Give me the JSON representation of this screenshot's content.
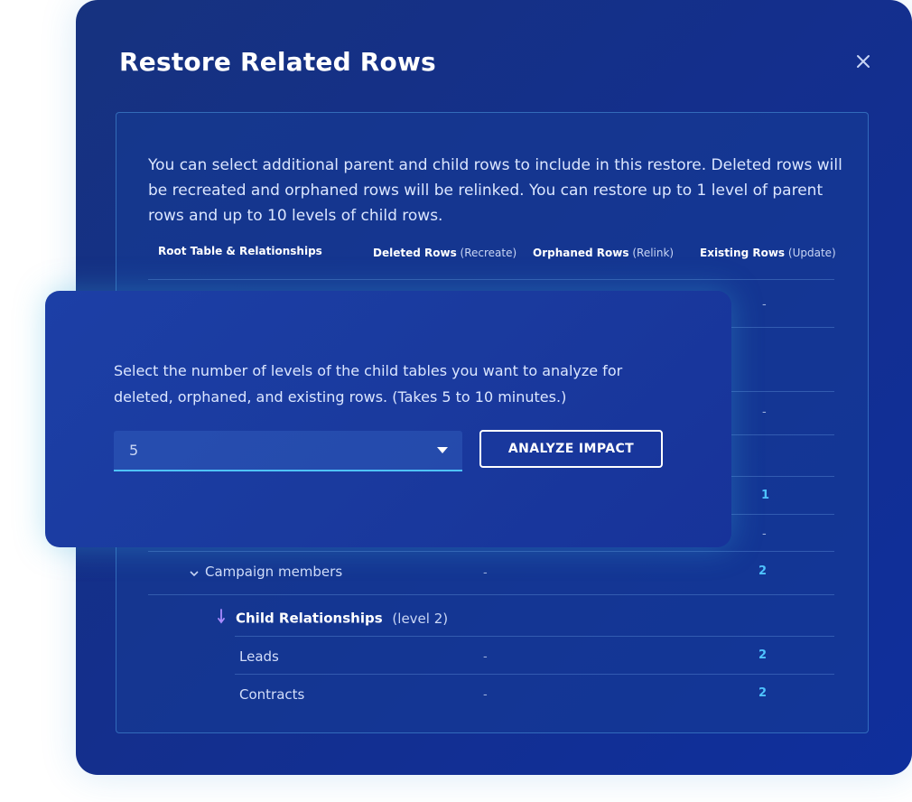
{
  "dialog": {
    "title": "Restore Related Rows",
    "intro": "You can select additional parent and child rows to include in this restore. Deleted rows will be recreated and orphaned rows will be relinked. You can restore up to 1 level of parent rows and up to 10 levels of child rows."
  },
  "table": {
    "headers": {
      "root": "Root Table & Relationships",
      "deleted": "Deleted Rows",
      "deleted_note": "(Recreate)",
      "orphaned": "Orphaned Rows",
      "orphaned_note": "(Relink)",
      "existing": "Existing Rows",
      "existing_note": "(Update)"
    },
    "partial_values": [
      "-",
      "-",
      "1",
      "-"
    ],
    "rows": [
      {
        "label": "Campaign members",
        "deleted": "-",
        "existing": "2"
      }
    ],
    "child_section": {
      "title": "Child Relationships",
      "level": "(level 2)"
    },
    "child_rows": [
      {
        "label": "Leads",
        "deleted": "-",
        "existing": "2"
      },
      {
        "label": "Contracts",
        "deleted": "-",
        "existing": "2"
      }
    ]
  },
  "popover": {
    "description": "Select the number of levels of the child tables you want to analyze for deleted, orphaned, and existing rows. (Takes 5 to 10 minutes.)",
    "levels_value": "5",
    "analyze_label": "ANALYZE IMPACT"
  },
  "colors": {
    "accent": "#4fc3ff",
    "child_arrow": "#a98bff",
    "modal_bg": "#142f8c"
  }
}
